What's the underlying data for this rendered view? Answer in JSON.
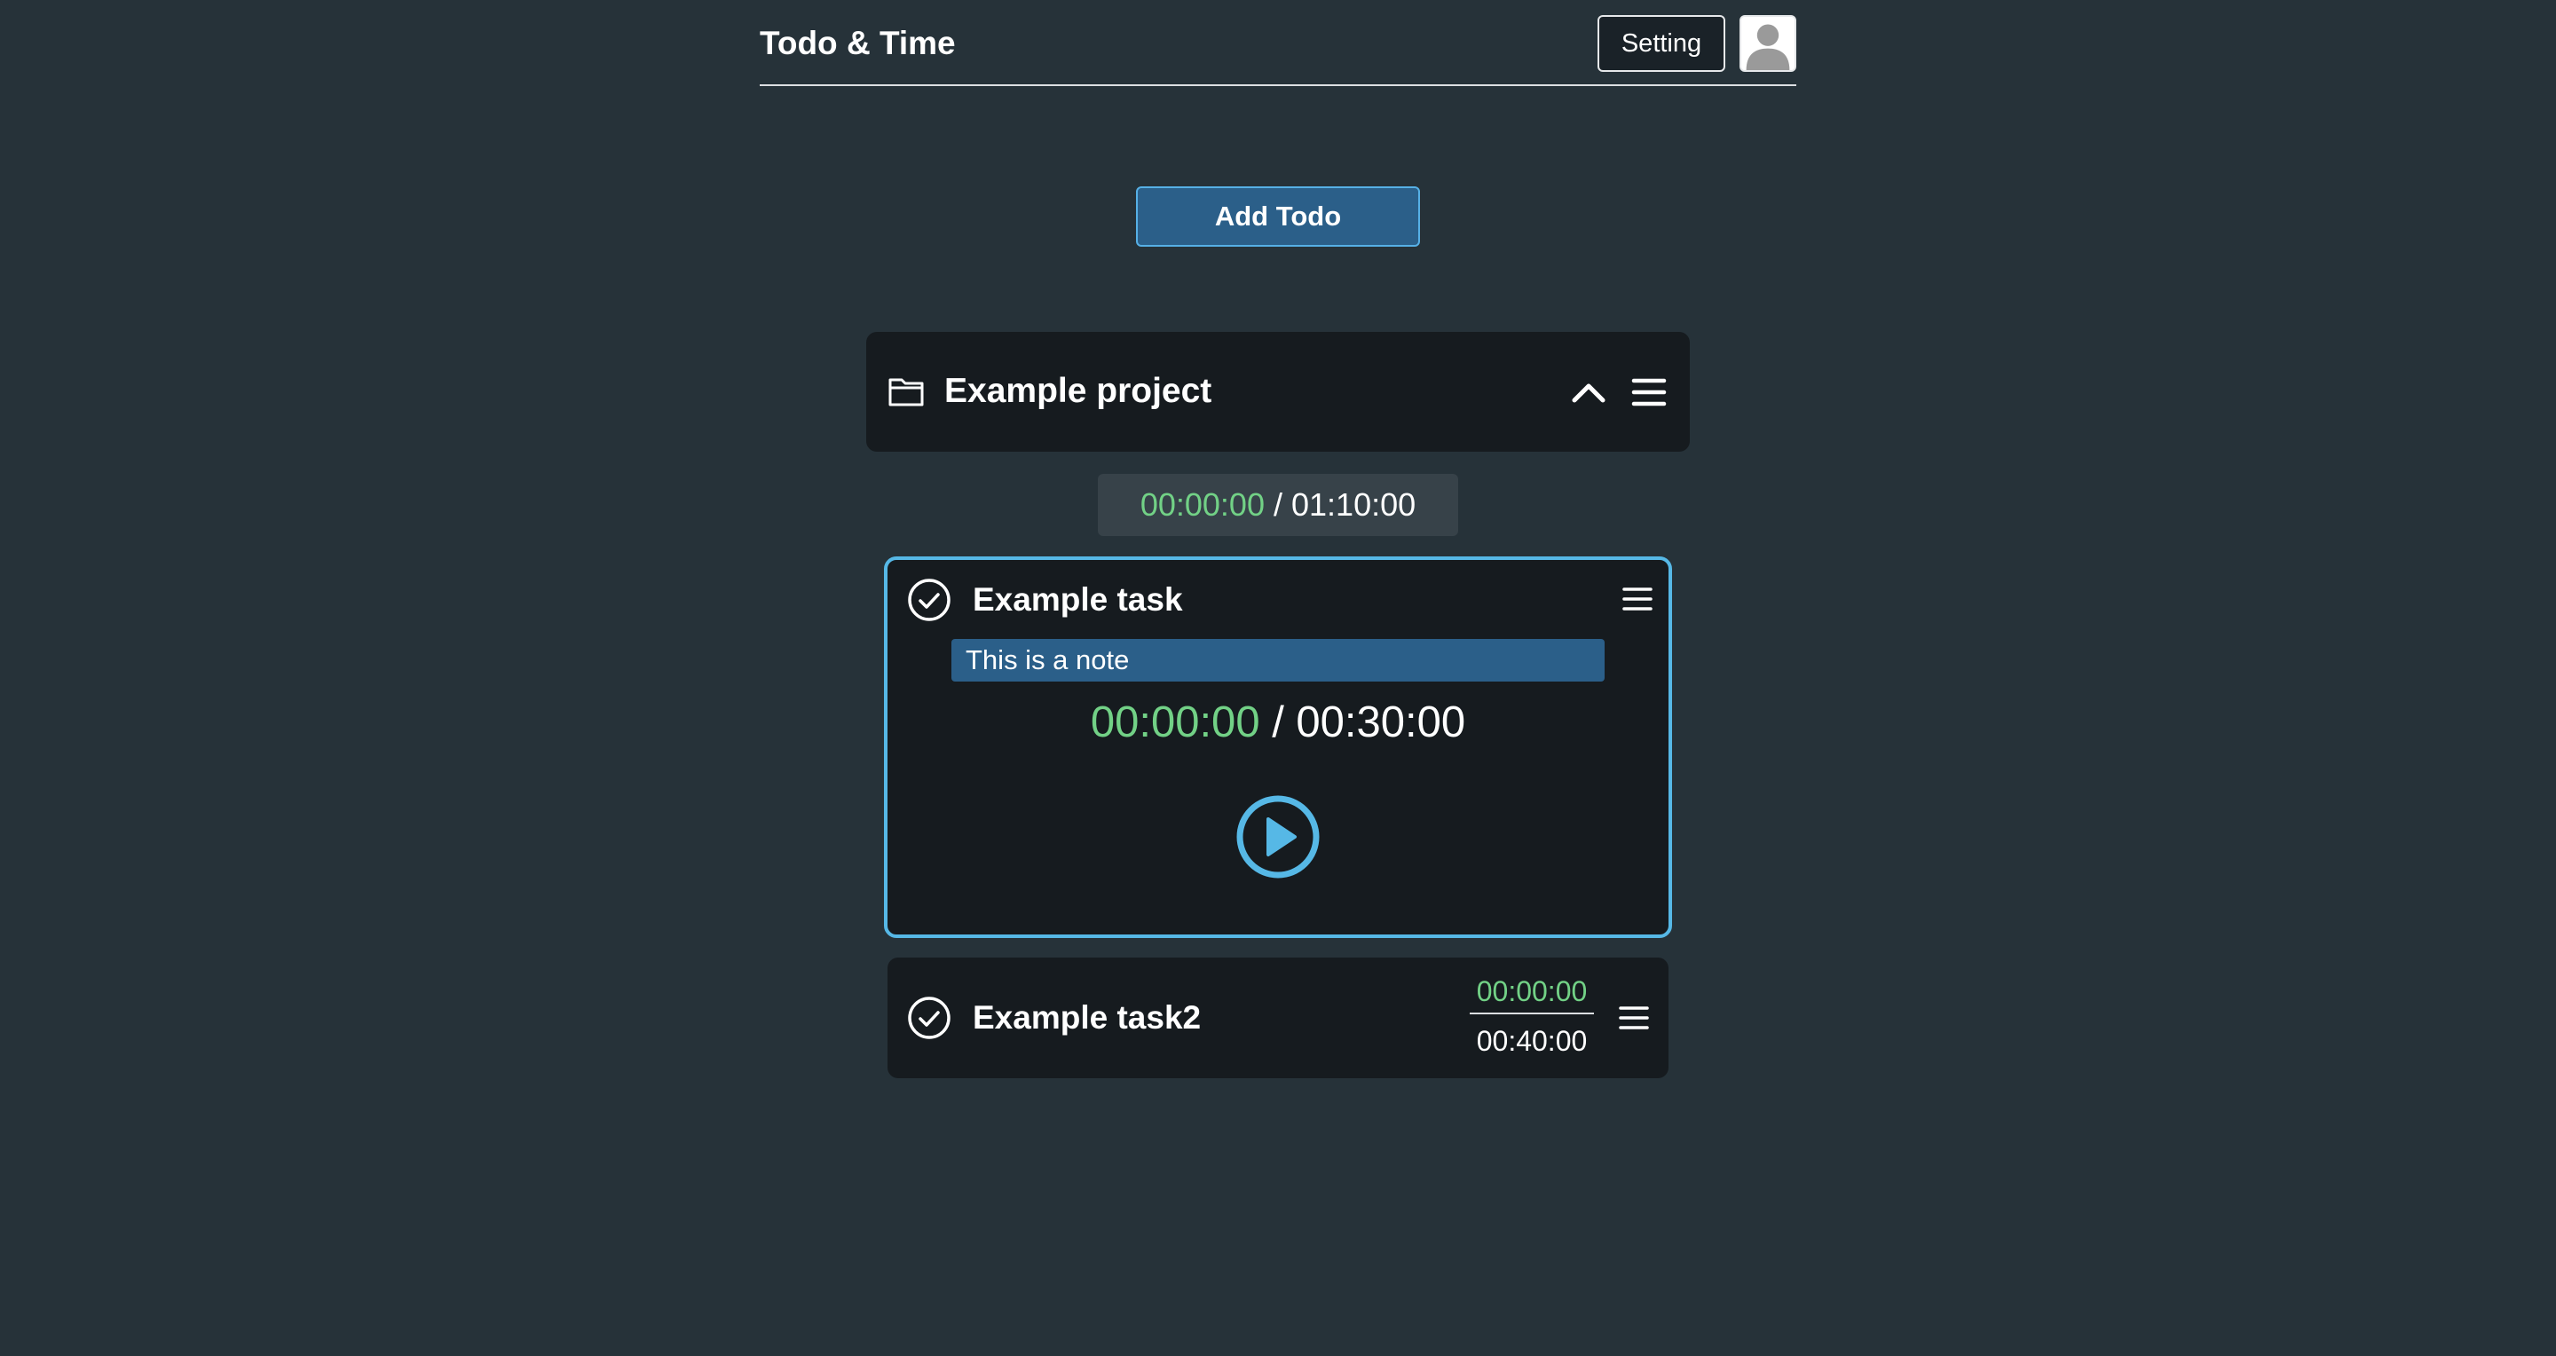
{
  "header": {
    "app_title": "Todo & Time",
    "setting_label": "Setting",
    "avatar_icon": "user-avatar-icon"
  },
  "add_todo_label": "Add Todo",
  "project": {
    "title": "Example project",
    "folder_icon": "folder-icon",
    "collapse_icon": "chevron-up-icon",
    "menu_icon": "menu-icon",
    "time_spent": "00:00:00",
    "time_total": "/ 01:10:00"
  },
  "tasks": [
    {
      "title": "Example task",
      "note": "This is a note",
      "time_spent": "00:00:00",
      "time_total": "/ 00:30:00",
      "active": true
    },
    {
      "title": "Example task2",
      "time_spent": "00:00:00",
      "time_total": "00:40:00",
      "active": false
    }
  ],
  "colors": {
    "background": "#263239",
    "card": "#161b1f",
    "accent": "#56b8e6",
    "button": "#2b5f89",
    "time_spent": "#72d186"
  }
}
